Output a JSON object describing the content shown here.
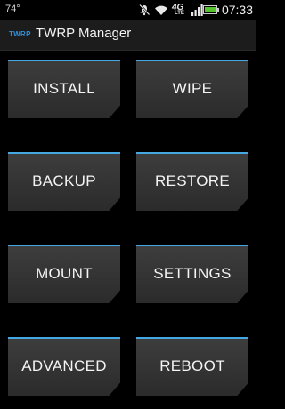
{
  "status_bar": {
    "temperature": "74°",
    "time": "07:33",
    "network_label": "4G",
    "network_sub": "LTE",
    "icons": [
      "mute-icon",
      "wifi-icon",
      "lte-icon",
      "signal-icon",
      "battery-icon"
    ]
  },
  "header": {
    "logo_text": "TWRP",
    "title": "TWRP Manager"
  },
  "colors": {
    "accent": "#46a8e0",
    "button_face": "#363636",
    "background": "#000000",
    "header": "#1c1c1c"
  },
  "menu": {
    "install": "INSTALL",
    "wipe": "WIPE",
    "backup": "BACKUP",
    "restore": "RESTORE",
    "mount": "MOUNT",
    "settings": "SETTINGS",
    "advanced": "ADVANCED",
    "reboot": "REBOOT"
  }
}
